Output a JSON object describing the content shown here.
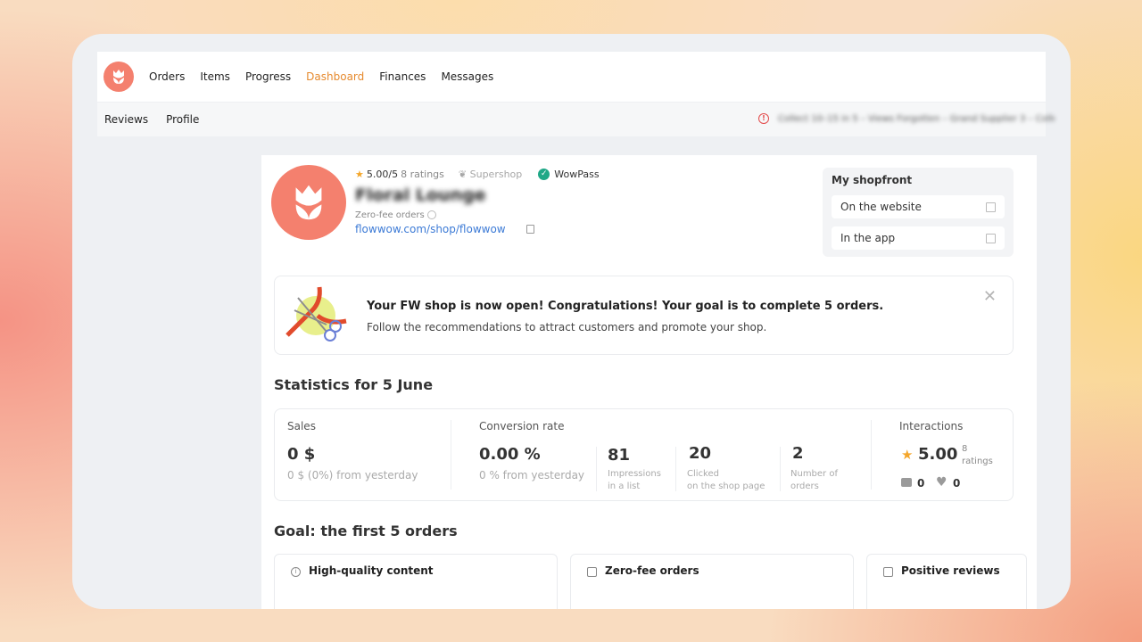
{
  "nav": {
    "items": [
      {
        "label": "Orders"
      },
      {
        "label": "Items"
      },
      {
        "label": "Progress"
      },
      {
        "label": "Dashboard",
        "active": true
      },
      {
        "label": "Finances"
      },
      {
        "label": "Messages"
      }
    ],
    "sub_items": [
      {
        "label": "Reviews"
      },
      {
        "label": "Profile"
      }
    ],
    "notice_text": "Collect 10–15 in 5 – Views Forgotten – Grand Supplier 3 – Collect"
  },
  "shop": {
    "rating": "5.00/5",
    "rating_count": "8 ratings",
    "supershop_label": "Supershop",
    "wowpass_label": "WowPass",
    "name": "Floral Lounge",
    "zero_fee_label": "Zero-fee orders",
    "link": "flowwow.com/shop/flowwow"
  },
  "shopfront": {
    "title": "My shopfront",
    "website_label": "On the website",
    "app_label": "In the app"
  },
  "banner": {
    "title": "Your FW shop is now open! Congratulations! Your goal is to complete 5 orders.",
    "subtitle": "Follow the recommendations to attract customers and promote your shop."
  },
  "stats": {
    "title": "Statistics for 5 June",
    "sales_label": "Sales",
    "sales_value": "0 $",
    "sales_change": "0 $ (0%) from yesterday",
    "conversion_label": "Conversion rate",
    "conversion_value": "0.00 %",
    "conversion_change": "0 % from yesterday",
    "impressions_value": "81",
    "impressions_label_1": "Impressions",
    "impressions_label_2": "in a list",
    "clicked_value": "20",
    "clicked_label_1": "Clicked",
    "clicked_label_2": "on the shop page",
    "orders_value": "2",
    "orders_label_1": "Number of",
    "orders_label_2": "orders",
    "interactions_label": "Interactions",
    "interactions_rating": "5.00",
    "interactions_rating_count": "8",
    "interactions_rating_word": "ratings",
    "cart_count": "0",
    "likes_count": "0"
  },
  "goal": {
    "title": "Goal: the first 5 orders",
    "cards": [
      {
        "label": "High-quality content"
      },
      {
        "label": "Zero-fee orders"
      },
      {
        "label": "Positive reviews"
      }
    ]
  },
  "colors": {
    "accent": "#e68a2e",
    "brand": "#f4806e",
    "link": "#3d7bd6",
    "wowpass": "#1fa887",
    "star": "#f4a62a",
    "alert": "#e34a4a"
  }
}
